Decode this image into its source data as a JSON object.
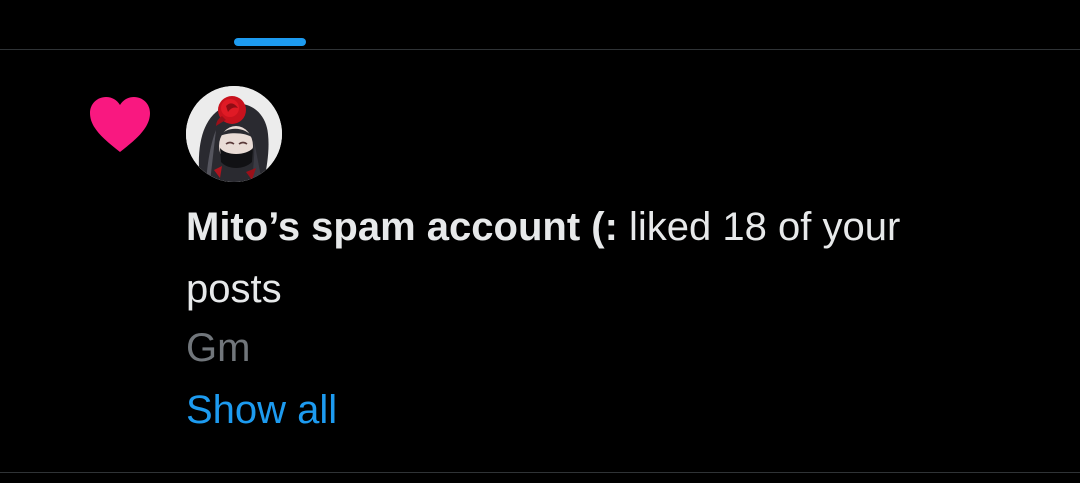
{
  "colors": {
    "background": "#000000",
    "accent": "#1d9bf0",
    "like": "#f91880",
    "text_primary": "#e7e9ea",
    "text_secondary": "#71767b",
    "divider": "#2f3336"
  },
  "notification": {
    "type_icon": "heart-icon",
    "avatar": "avatar",
    "actor_name": "Mito’s spam account (:",
    "action_text": " liked 18 of your posts",
    "post_text": "Gm",
    "show_all_label": "Show all"
  }
}
